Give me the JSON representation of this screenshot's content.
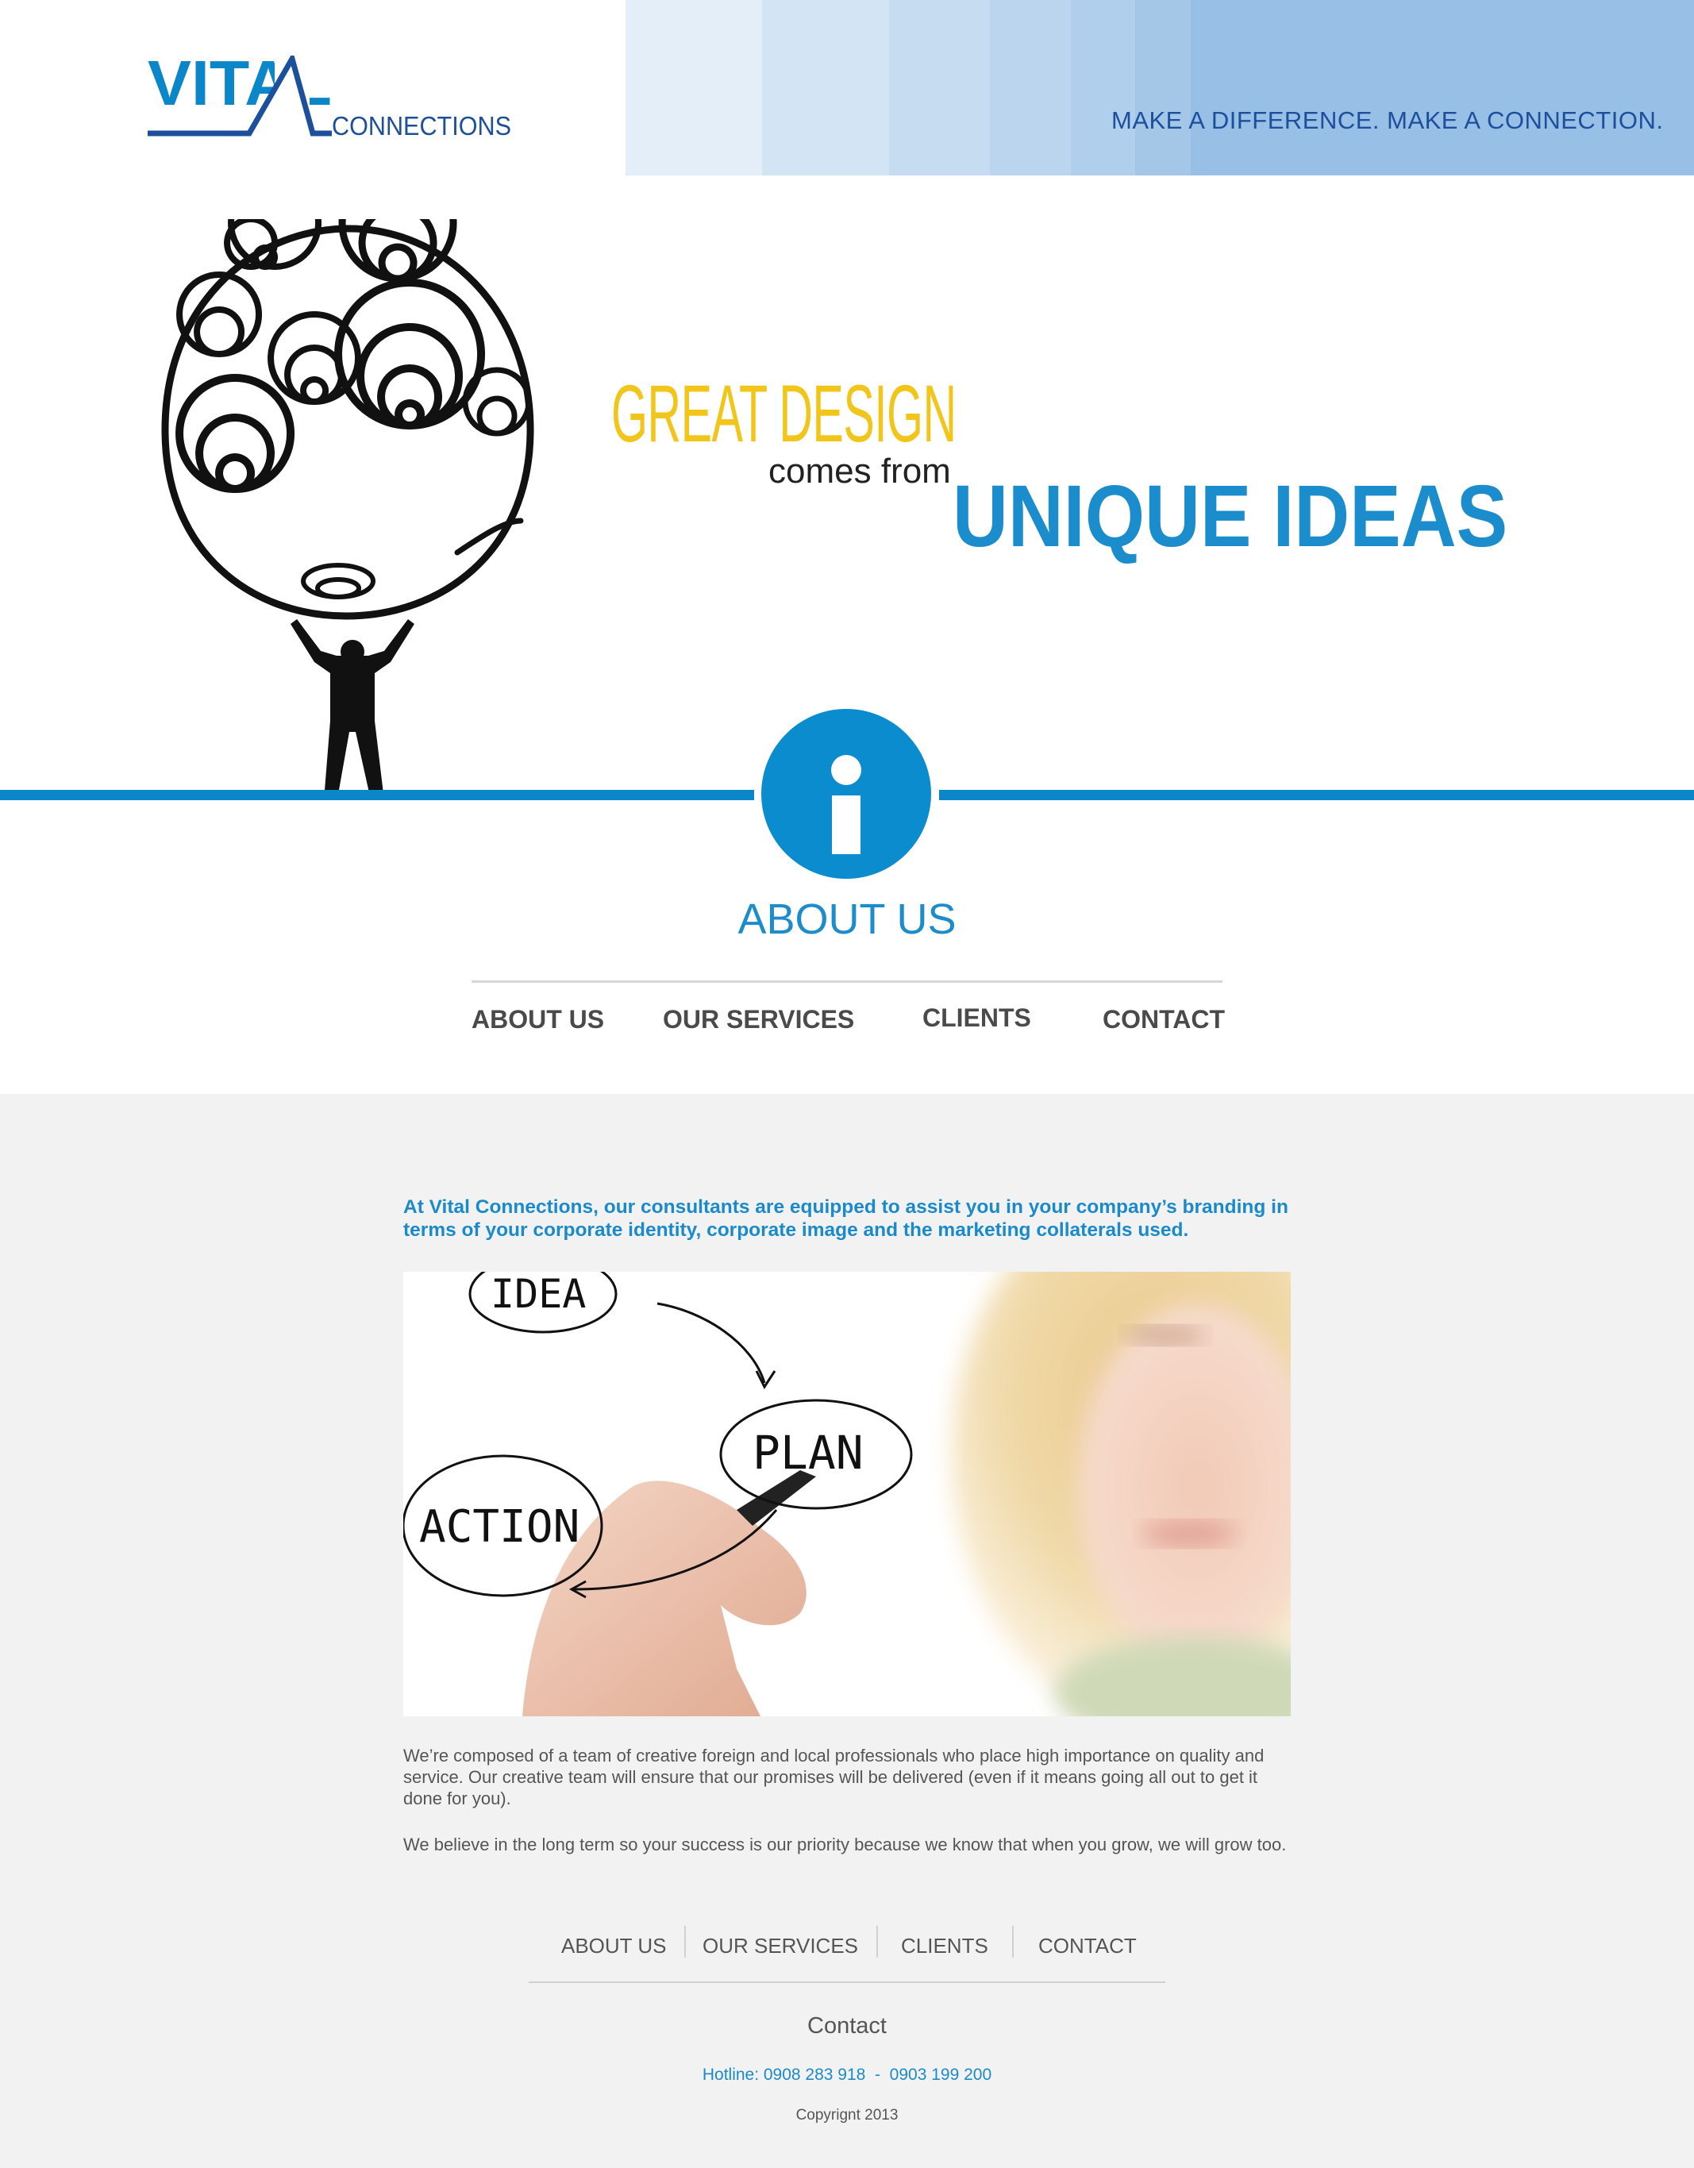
{
  "brand": {
    "logo_main": "VITAL",
    "logo_sub": "CONNECTIONS",
    "tagline": "MAKE A DIFFERENCE. MAKE A CONNECTION.",
    "colors": {
      "primary_blue": "#0b86c9",
      "accent_yellow": "#f2c51b",
      "header_stripes": [
        "#e3eef8",
        "#d3e4f4",
        "#c6dcf1",
        "#bbd5ee",
        "#b0cfec",
        "#a4c7e8",
        "#98bfe5"
      ]
    }
  },
  "hero": {
    "line1": "GREAT DESIGN",
    "line2": "comes from",
    "line3": "UNIQUE IDEAS",
    "illustration": "person-holding-swirl-tree"
  },
  "section": {
    "icon": "info-icon",
    "title": "ABOUT US"
  },
  "top_nav": [
    {
      "label": "ABOUT US"
    },
    {
      "label": "OUR SERVICES"
    },
    {
      "label": "CLIENTS"
    },
    {
      "label": "CONTACT"
    }
  ],
  "content": {
    "intro": "At Vital Connections, our consultants are equipped to assist you in your company’s branding in terms of your corporate identity, corporate image and the marketing collaterals used.",
    "photo": {
      "words": [
        "IDEA",
        "PLAN",
        "ACTION"
      ]
    },
    "paragraph1": "We’re composed of a team of creative foreign and local professionals who place high importance on quality and service. Our creative team will ensure that our promises will be delivered (even if it means going all out to get it done for you).",
    "paragraph2": "We believe in the long term so your success is our priority because we know that when you grow, we will grow too."
  },
  "footer": {
    "nav": [
      {
        "label": "ABOUT US"
      },
      {
        "label": "OUR SERVICES"
      },
      {
        "label": "CLIENTS"
      },
      {
        "label": "CONTACT"
      }
    ],
    "contact_heading": "Contact",
    "hotline": "Hotline: 0908 283 918  -  0903 199 200",
    "copyright": "Copyrignt 2013"
  }
}
